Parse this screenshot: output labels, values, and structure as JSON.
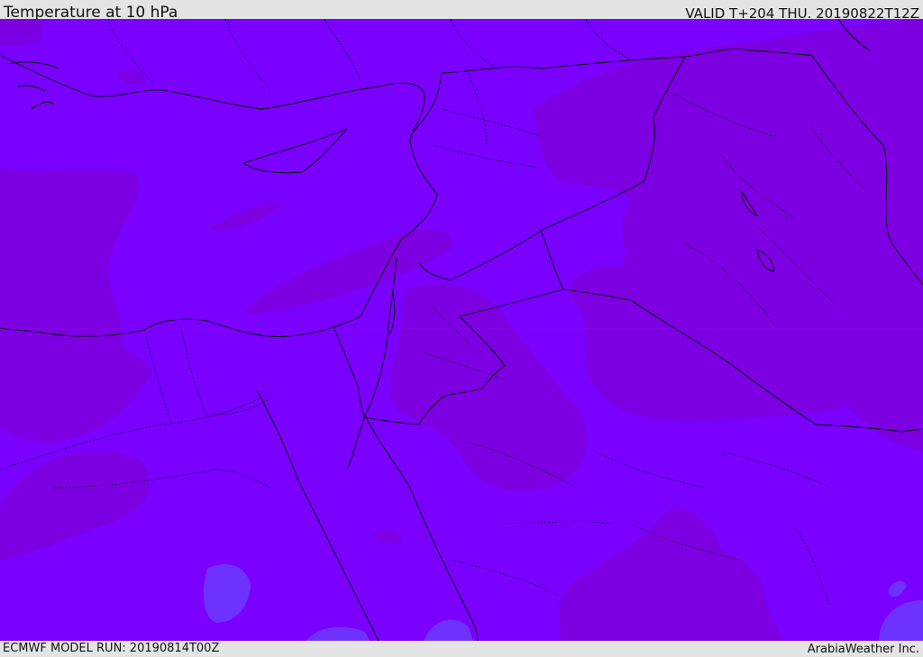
{
  "header": {
    "title": "Temperature at 10 hPa",
    "valid": "VALID T+204 THU. 20190822T12Z"
  },
  "footer": {
    "model_run": "ECMWF MODEL RUN: 20190814T00Z",
    "credit": "ArabiaWeather Inc."
  },
  "map": {
    "field_colors": {
      "base": "#7a00ff",
      "darker_band": "#7c00e2",
      "lighter_band": "#6e32ff",
      "country_border": "#000000"
    }
  }
}
